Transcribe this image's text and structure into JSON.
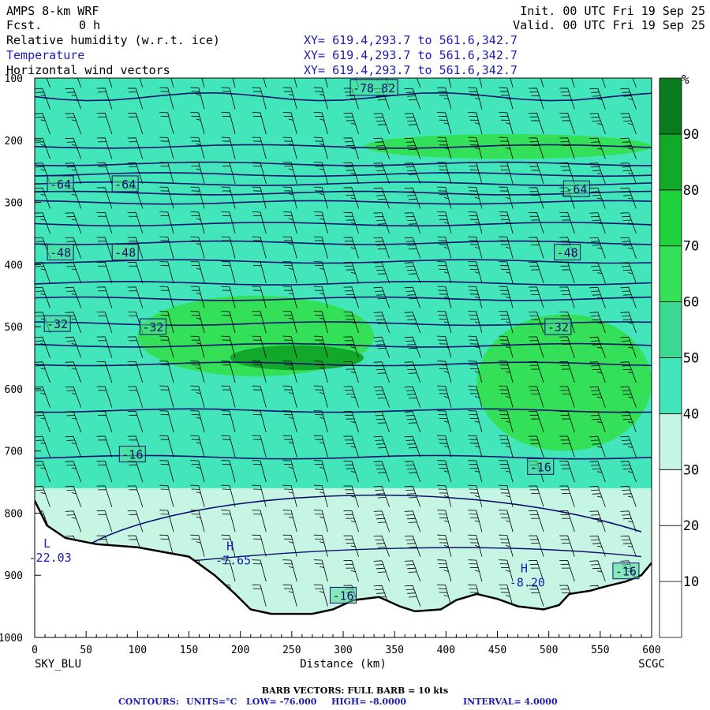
{
  "header": {
    "model": "AMPS 8-km WRF",
    "fcst_label": "Fcst.",
    "fcst_value": "0 h",
    "init_text": "Init. 00 UTC Fri 19 Sep 25",
    "valid_text": "Valid. 00 UTC Fri 19 Sep 25",
    "fields": [
      {
        "name": "Relative humidity (w.r.t. ice)",
        "xy": "XY= 619.4,293.7 to 561.6,342.7"
      },
      {
        "name": "Temperature",
        "xy": "XY= 619.4,293.7 to 561.6,342.7"
      },
      {
        "name": "Horizontal wind vectors",
        "xy": "XY= 619.4,293.7 to 561.6,342.7"
      }
    ]
  },
  "colors": {
    "temperature_text": "#1c1cb4",
    "contour": "#101070",
    "terrain": "#000000"
  },
  "chart_data": {
    "type": "heatmap",
    "title": "AMPS 8-km WRF",
    "xlabel": "Distance (km)",
    "ylabel": "",
    "xlim": [
      0,
      600
    ],
    "ylim": [
      1000,
      100
    ],
    "x_ticks": [
      "0",
      "50",
      "100",
      "150",
      "200",
      "250",
      "300",
      "350",
      "400",
      "450",
      "500",
      "550",
      "600"
    ],
    "y_ticks": [
      "100",
      "200",
      "300",
      "400",
      "500",
      "600",
      "700",
      "800",
      "900",
      "1000"
    ],
    "left_endpoint": "SKY_BLU",
    "right_endpoint": "SCGC",
    "colorbar": {
      "unit": "%",
      "tick_labels": [
        "10",
        "20",
        "30",
        "40",
        "50",
        "60",
        "70",
        "80",
        "90"
      ],
      "levels": [
        {
          "from": 0,
          "to": 10,
          "color": "#ffffff"
        },
        {
          "from": 10,
          "to": 20,
          "color": "#ffffff"
        },
        {
          "from": 20,
          "to": 30,
          "color": "#ffffff"
        },
        {
          "from": 30,
          "to": 40,
          "color": "#c6f5e3"
        },
        {
          "from": 40,
          "to": 50,
          "color": "#43e6bb"
        },
        {
          "from": 50,
          "to": 60,
          "color": "#3ad890"
        },
        {
          "from": 60,
          "to": 70,
          "color": "#33e058"
        },
        {
          "from": 70,
          "to": 80,
          "color": "#1fd13a"
        },
        {
          "from": 80,
          "to": 90,
          "color": "#12a82a"
        },
        {
          "from": 90,
          "to": 100,
          "color": "#0a7a1e"
        }
      ]
    },
    "rh_regions": [
      {
        "p_top": 100,
        "p_bottom": 760,
        "rh": 45
      },
      {
        "p_top": 190,
        "p_bottom": 230,
        "rh": 65,
        "x_from": 320,
        "x_to": 600
      },
      {
        "p_top": 450,
        "p_bottom": 580,
        "rh": 65,
        "x_from": 100,
        "x_to": 330
      },
      {
        "p_top": 530,
        "p_bottom": 570,
        "rh": 85,
        "x_from": 190,
        "x_to": 320
      },
      {
        "p_top": 480,
        "p_bottom": 700,
        "rh": 65,
        "x_from": 430,
        "x_to": 600
      },
      {
        "p_top": 760,
        "p_bottom": 960,
        "rh": 35
      }
    ],
    "temperature_contours_degC": {
      "low": "-76.000",
      "high": "-8.0000",
      "interval": "4.0000",
      "levels": [
        -76,
        -72,
        -68,
        -64,
        -60,
        -56,
        -52,
        -48,
        -44,
        -40,
        -36,
        -32,
        -28,
        -24,
        -20,
        -16
      ],
      "pressure_at_level": [
        210,
        238,
        255,
        270,
        285,
        300,
        335,
        365,
        395,
        430,
        455,
        495,
        530,
        560,
        635,
        710
      ]
    },
    "contour_labels": [
      {
        "text": "-78 82",
        "x": 330,
        "p": 115
      },
      {
        "text": "-64",
        "x": 25,
        "p": 270
      },
      {
        "text": "-64",
        "x": 88,
        "p": 270
      },
      {
        "text": "-64",
        "x": 527,
        "p": 278
      },
      {
        "text": "-48",
        "x": 25,
        "p": 380
      },
      {
        "text": "-48",
        "x": 88,
        "p": 380
      },
      {
        "text": "-48",
        "x": 518,
        "p": 380
      },
      {
        "text": "-32",
        "x": 22,
        "p": 495
      },
      {
        "text": "-32",
        "x": 115,
        "p": 500
      },
      {
        "text": "-32",
        "x": 509,
        "p": 500
      },
      {
        "text": "-16",
        "x": 95,
        "p": 705
      },
      {
        "text": "-16",
        "x": 492,
        "p": 725
      },
      {
        "text": "-16",
        "x": 300,
        "p": 932
      },
      {
        "text": "-16",
        "x": 575,
        "p": 893
      }
    ],
    "extrema": [
      {
        "mark": "L",
        "value": "-22.03",
        "x": 12,
        "p": 855
      },
      {
        "mark": "H",
        "value": "-7.65",
        "x": 190,
        "p": 860
      },
      {
        "mark": "H",
        "value": "-8.20",
        "x": 476,
        "p": 895
      }
    ],
    "terrain_pressure": [
      {
        "x": 0,
        "p": 780
      },
      {
        "x": 12,
        "p": 820
      },
      {
        "x": 30,
        "p": 840
      },
      {
        "x": 60,
        "p": 850
      },
      {
        "x": 100,
        "p": 855
      },
      {
        "x": 150,
        "p": 870
      },
      {
        "x": 175,
        "p": 900
      },
      {
        "x": 195,
        "p": 930
      },
      {
        "x": 210,
        "p": 955
      },
      {
        "x": 230,
        "p": 962
      },
      {
        "x": 270,
        "p": 962
      },
      {
        "x": 290,
        "p": 955
      },
      {
        "x": 310,
        "p": 940
      },
      {
        "x": 335,
        "p": 935
      },
      {
        "x": 355,
        "p": 950
      },
      {
        "x": 370,
        "p": 958
      },
      {
        "x": 395,
        "p": 955
      },
      {
        "x": 410,
        "p": 940
      },
      {
        "x": 430,
        "p": 930
      },
      {
        "x": 450,
        "p": 938
      },
      {
        "x": 470,
        "p": 950
      },
      {
        "x": 495,
        "p": 955
      },
      {
        "x": 510,
        "p": 948
      },
      {
        "x": 520,
        "p": 930
      },
      {
        "x": 540,
        "p": 925
      },
      {
        "x": 555,
        "p": 918
      },
      {
        "x": 575,
        "p": 910
      },
      {
        "x": 590,
        "p": 900
      },
      {
        "x": 600,
        "p": 880
      }
    ],
    "wind_barbs": {
      "x_positions": [
        15,
        45,
        75,
        105,
        135,
        165,
        195,
        225,
        255,
        285,
        315,
        345,
        375,
        405,
        435,
        465,
        495,
        525,
        555,
        585
      ],
      "pressure_levels": [
        115,
        150,
        190,
        230,
        270,
        310,
        350,
        390,
        430,
        470,
        510,
        550,
        590,
        630,
        670,
        710,
        750,
        790,
        830,
        870,
        910,
        950
      ],
      "speed_kts_by_column": [
        25,
        25,
        20,
        20,
        20,
        25,
        20,
        20,
        25,
        25,
        35,
        40,
        40,
        35,
        35,
        35,
        30,
        30,
        35,
        35
      ],
      "barb_tilt_deg_by_column": [
        -20,
        -20,
        -18,
        -18,
        -15,
        -15,
        -15,
        -15,
        -15,
        -15,
        -18,
        -20,
        -20,
        -15,
        -15,
        -15,
        -18,
        -18,
        -20,
        -20
      ]
    },
    "footer": {
      "barb_text": "BARB VECTORS:  FULL BARB = 10 kts",
      "contours_label": "CONTOURS:",
      "units": "UNITS=°C",
      "low": "LOW= -76.000",
      "high": "HIGH= -8.0000",
      "interval": "INTERVAL=  4.0000"
    }
  }
}
